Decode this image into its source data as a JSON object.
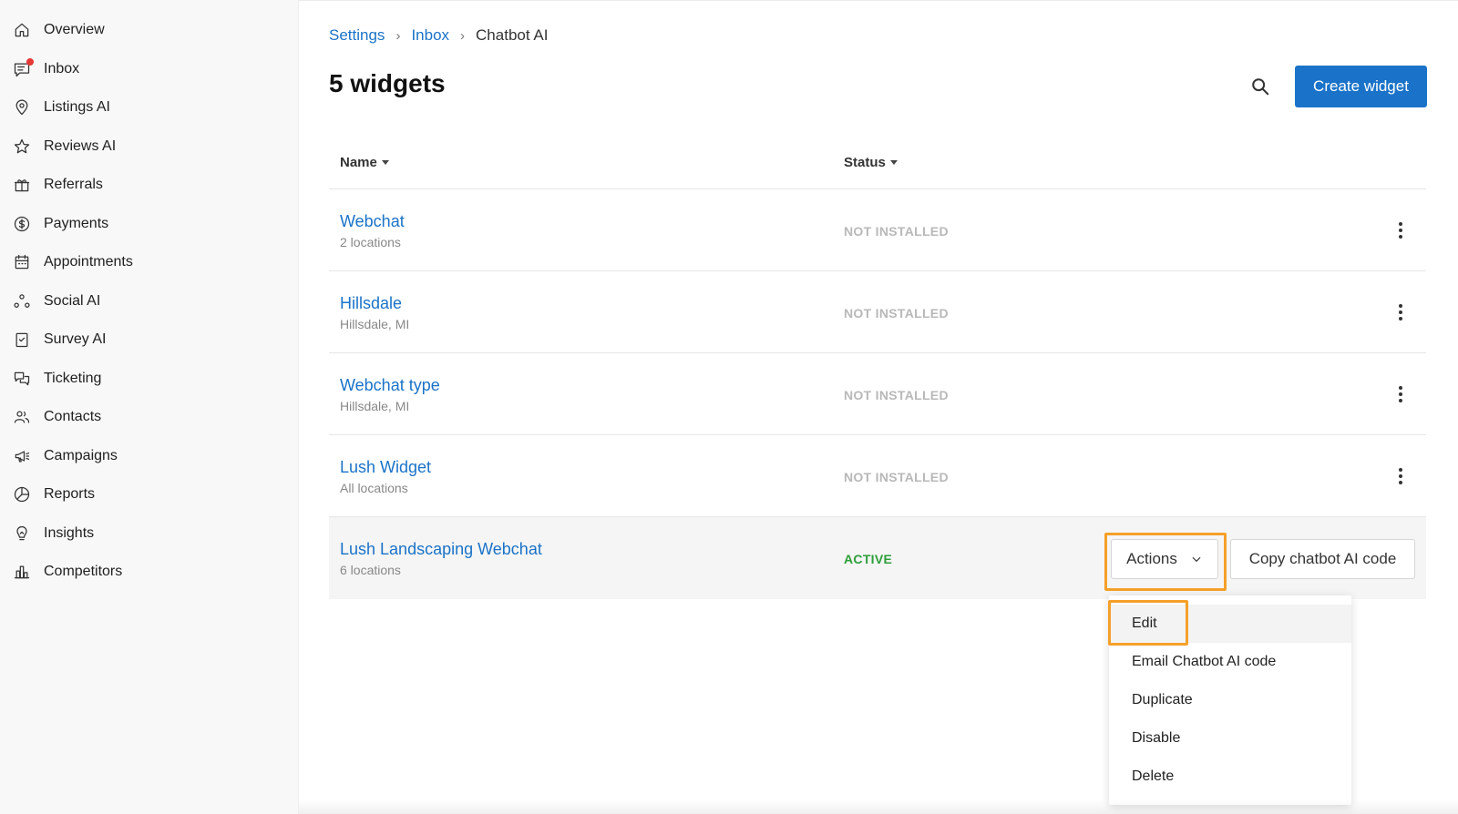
{
  "sidebar": {
    "items": [
      {
        "label": "Overview",
        "icon": "home-icon"
      },
      {
        "label": "Inbox",
        "icon": "inbox-icon",
        "notification": true
      },
      {
        "label": "Listings AI",
        "icon": "location-pin-icon"
      },
      {
        "label": "Reviews AI",
        "icon": "star-icon"
      },
      {
        "label": "Referrals",
        "icon": "gift-icon"
      },
      {
        "label": "Payments",
        "icon": "dollar-icon"
      },
      {
        "label": "Appointments",
        "icon": "calendar-icon"
      },
      {
        "label": "Social AI",
        "icon": "social-nodes-icon"
      },
      {
        "label": "Survey AI",
        "icon": "clipboard-check-icon"
      },
      {
        "label": "Ticketing",
        "icon": "chat-bubbles-icon"
      },
      {
        "label": "Contacts",
        "icon": "people-icon"
      },
      {
        "label": "Campaigns",
        "icon": "megaphone-icon"
      },
      {
        "label": "Reports",
        "icon": "pie-chart-icon"
      },
      {
        "label": "Insights",
        "icon": "lightbulb-icon"
      },
      {
        "label": "Competitors",
        "icon": "bar-chart-icon"
      }
    ]
  },
  "breadcrumb": {
    "items": [
      "Settings",
      "Inbox"
    ],
    "current": "Chatbot AI"
  },
  "header": {
    "title": "5 widgets",
    "create_label": "Create widget"
  },
  "table": {
    "columns": {
      "name": "Name",
      "status": "Status"
    },
    "rows": [
      {
        "name": "Webchat",
        "sub": "2 locations",
        "status": "NOT INSTALLED"
      },
      {
        "name": "Hillsdale",
        "sub": "Hillsdale, MI",
        "status": "NOT INSTALLED"
      },
      {
        "name": "Webchat type",
        "sub": "Hillsdale, MI",
        "status": "NOT INSTALLED"
      },
      {
        "name": "Lush Widget",
        "sub": "All locations",
        "status": "NOT INSTALLED"
      },
      {
        "name": "Lush Landscaping Webchat",
        "sub": "6 locations",
        "status": "ACTIVE"
      }
    ]
  },
  "row_actions": {
    "actions_label": "Actions",
    "copy_label": "Copy chatbot AI code"
  },
  "menu": {
    "items": [
      "Edit",
      "Email Chatbot AI code",
      "Duplicate",
      "Disable",
      "Delete"
    ]
  },
  "colors": {
    "primary": "#1a73c8",
    "active": "#2e9e3a",
    "inactive": "#b8b8b8",
    "highlight": "#f5a02a"
  }
}
